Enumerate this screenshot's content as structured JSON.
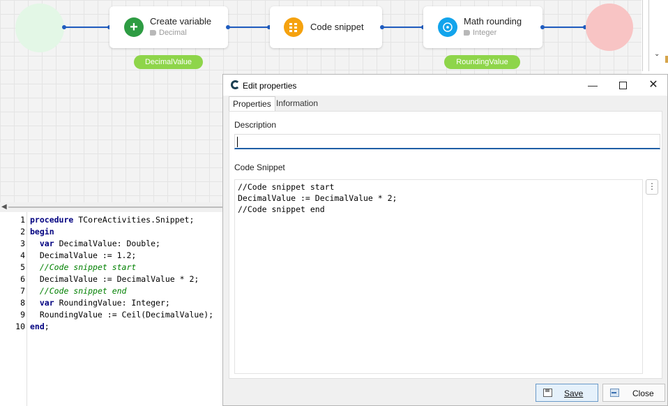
{
  "flow": {
    "nodes": [
      {
        "title": "Create variable",
        "subtitle": "Decimal",
        "icon": "plus-icon",
        "color": "#2e9c43"
      },
      {
        "title": "Code snippet",
        "subtitle": "",
        "icon": "grid-icon",
        "color": "#f5a20f"
      },
      {
        "title": "Math rounding",
        "subtitle": "Integer",
        "icon": "target-icon",
        "color": "#12a4ec"
      }
    ],
    "variables": [
      "DecimalValue",
      "RoundingValue"
    ],
    "start_color": "#e3f7e6",
    "end_color": "#f8c4c4",
    "edge_color": "#1f5cbf",
    "pill_color": "#8ed54a"
  },
  "editor": {
    "lines": [
      {
        "n": "1",
        "parts": [
          {
            "t": "procedure",
            "c": "kw"
          },
          {
            "t": " TCoreActivities.Snippet;",
            "c": ""
          }
        ]
      },
      {
        "n": "2",
        "parts": [
          {
            "t": "begin",
            "c": "kw"
          }
        ]
      },
      {
        "n": "3",
        "parts": [
          {
            "t": "  ",
            "c": ""
          },
          {
            "t": "var",
            "c": "kw"
          },
          {
            "t": " DecimalValue: Double;",
            "c": ""
          }
        ]
      },
      {
        "n": "4",
        "parts": [
          {
            "t": "  DecimalValue := 1.2;",
            "c": ""
          }
        ]
      },
      {
        "n": "5",
        "parts": [
          {
            "t": "  ",
            "c": ""
          },
          {
            "t": "//Code snippet start",
            "c": "cmt"
          }
        ]
      },
      {
        "n": "6",
        "parts": [
          {
            "t": "  DecimalValue := DecimalValue * 2;",
            "c": ""
          }
        ]
      },
      {
        "n": "7",
        "parts": [
          {
            "t": "  ",
            "c": ""
          },
          {
            "t": "//Code snippet end",
            "c": "cmt"
          }
        ]
      },
      {
        "n": "8",
        "parts": [
          {
            "t": "  ",
            "c": ""
          },
          {
            "t": "var",
            "c": "kw"
          },
          {
            "t": " RoundingValue: Integer;",
            "c": ""
          }
        ]
      },
      {
        "n": "9",
        "parts": [
          {
            "t": "  RoundingValue := Ceil(DecimalValue);",
            "c": ""
          }
        ]
      },
      {
        "n": "10",
        "parts": [
          {
            "t": "end",
            "c": "kw"
          },
          {
            "t": ";",
            "c": ""
          }
        ]
      }
    ]
  },
  "dialog": {
    "title": "Edit properties",
    "tabs": [
      "Properties",
      "Information"
    ],
    "active_tab": "Properties",
    "description_label": "Description",
    "description_value": "",
    "snippet_label": "Code Snippet",
    "snippet_lines": [
      "//Code snippet start",
      "DecimalValue := DecimalValue * 2;",
      "//Code snippet end"
    ],
    "more_button": "⋮",
    "save_label": "Save",
    "close_label": "Close"
  }
}
